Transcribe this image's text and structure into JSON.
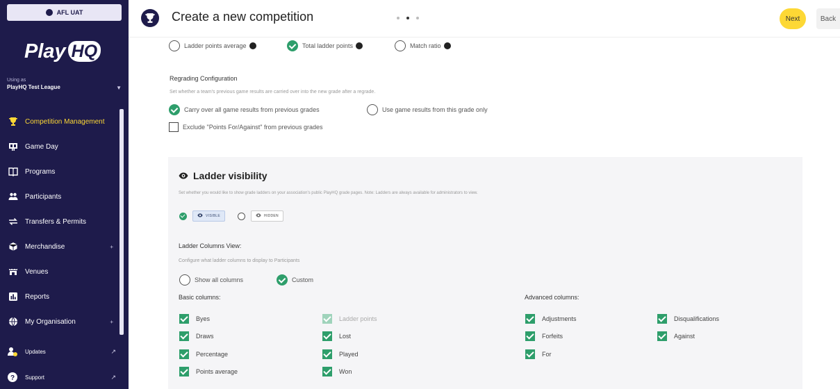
{
  "sidebar": {
    "org_pill": "AFL UAT",
    "logo_text": "Play",
    "logo_hq": "HQ",
    "org_label": "Using as",
    "org_name": "PlayHQ Test League",
    "items": [
      {
        "label": "Competition Management",
        "icon": "trophy-icon"
      },
      {
        "label": "Game Day",
        "icon": "scoreboard-icon"
      },
      {
        "label": "Programs",
        "icon": "book-icon"
      },
      {
        "label": "Participants",
        "icon": "people-icon"
      },
      {
        "label": "Transfers & Permits",
        "icon": "transfer-icon"
      },
      {
        "label": "Merchandise",
        "icon": "merchandise-icon"
      },
      {
        "label": "Venues",
        "icon": "stadium-icon"
      },
      {
        "label": "Reports",
        "icon": "reports-icon"
      },
      {
        "label": "My Organisation",
        "icon": "globe-icon"
      }
    ],
    "updates_label": "Updates",
    "support_label": "Support"
  },
  "header": {
    "title": "Create a new competition",
    "next_label": "Next",
    "back_label": "Back",
    "step_current": 2,
    "step_total": 3
  },
  "ladder_points": {
    "options": [
      "Ladder points average",
      "Total ladder points",
      "Match ratio"
    ],
    "selected": "Total ladder points"
  },
  "regrading": {
    "title": "Regrading Configuration",
    "description": "Set whether a team's previous game results are carried over into the new grade after a regrade.",
    "option_carry": "Carry over all game results from previous grades",
    "option_use": "Use game results from this grade only",
    "selected": "carry",
    "exclude_label": "Exclude \"Points For/Against\" from previous grades",
    "exclude_checked": false
  },
  "ladder_visibility": {
    "title": "Ladder visibility",
    "description": "Set whether you would like to show grade ladders on your association's public PlayHQ grade pages. Note: Ladders are always available for administrators to view.",
    "option_visible": "VISIBLE",
    "option_hidden": "HIDDEN",
    "selected": "visible",
    "columns_title": "Ladder Columns View:",
    "columns_description": "Configure what ladder columns to display to Participants",
    "option_show_all": "Show all columns",
    "option_custom": "Custom",
    "columns_selected": "custom",
    "basic_title": "Basic columns:",
    "advanced_title": "Advanced columns:",
    "basic_col1": [
      {
        "label": "Byes",
        "checked": true,
        "disabled": false
      },
      {
        "label": "Draws",
        "checked": true,
        "disabled": false
      },
      {
        "label": "Percentage",
        "checked": true,
        "disabled": false
      },
      {
        "label": "Points average",
        "checked": true,
        "disabled": false
      }
    ],
    "basic_col2": [
      {
        "label": "Ladder points",
        "checked": true,
        "disabled": true
      },
      {
        "label": "Lost",
        "checked": true,
        "disabled": false
      },
      {
        "label": "Played",
        "checked": true,
        "disabled": false
      },
      {
        "label": "Won",
        "checked": true,
        "disabled": false
      }
    ],
    "advanced_col1": [
      {
        "label": "Adjustments",
        "checked": true,
        "disabled": false
      },
      {
        "label": "Forfeits",
        "checked": true,
        "disabled": false
      },
      {
        "label": "For",
        "checked": true,
        "disabled": false
      }
    ],
    "advanced_col2": [
      {
        "label": "Disqualifications",
        "checked": true,
        "disabled": false
      },
      {
        "label": "Against",
        "checked": true,
        "disabled": false
      }
    ]
  },
  "colors": {
    "sidebar_bg": "#1e1b4b",
    "accent_yellow": "#fdd835",
    "check_green": "#2e9e6b"
  }
}
